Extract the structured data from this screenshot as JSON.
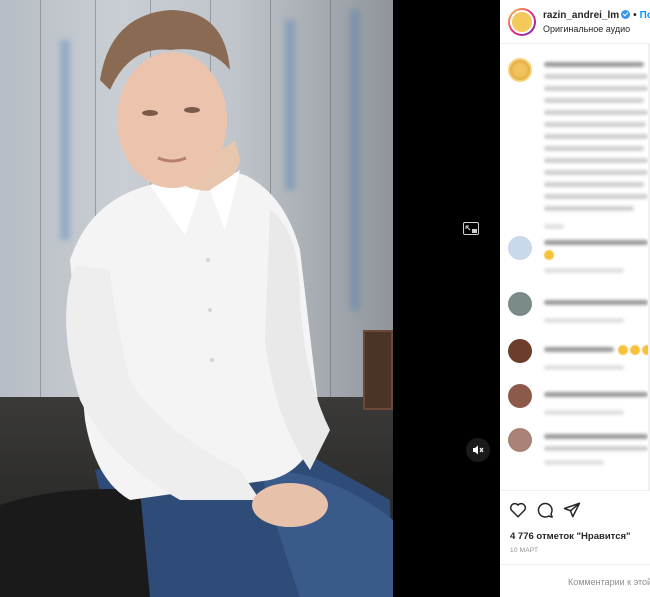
{
  "post": {
    "username": "razin_andrei_lm",
    "follow_label": "Подписаться",
    "audio_label": "Оригинальное аудио"
  },
  "actions": {
    "likes_text": "4 776 отметок \"Нравится\"",
    "date_text": "10 МАРТ",
    "comment_placeholder": "Комментарии к этой публикации"
  },
  "icons": {
    "like": "heart-icon",
    "comment": "comment-icon",
    "share": "send-icon",
    "pip": "picture-in-picture-icon",
    "mute": "muted-speaker-icon",
    "verified": "verified-badge-icon"
  },
  "colors": {
    "link_blue": "#0095f6",
    "verified_blue": "#3897f0",
    "text_dark": "#262626",
    "text_muted": "#8e8e8e"
  }
}
